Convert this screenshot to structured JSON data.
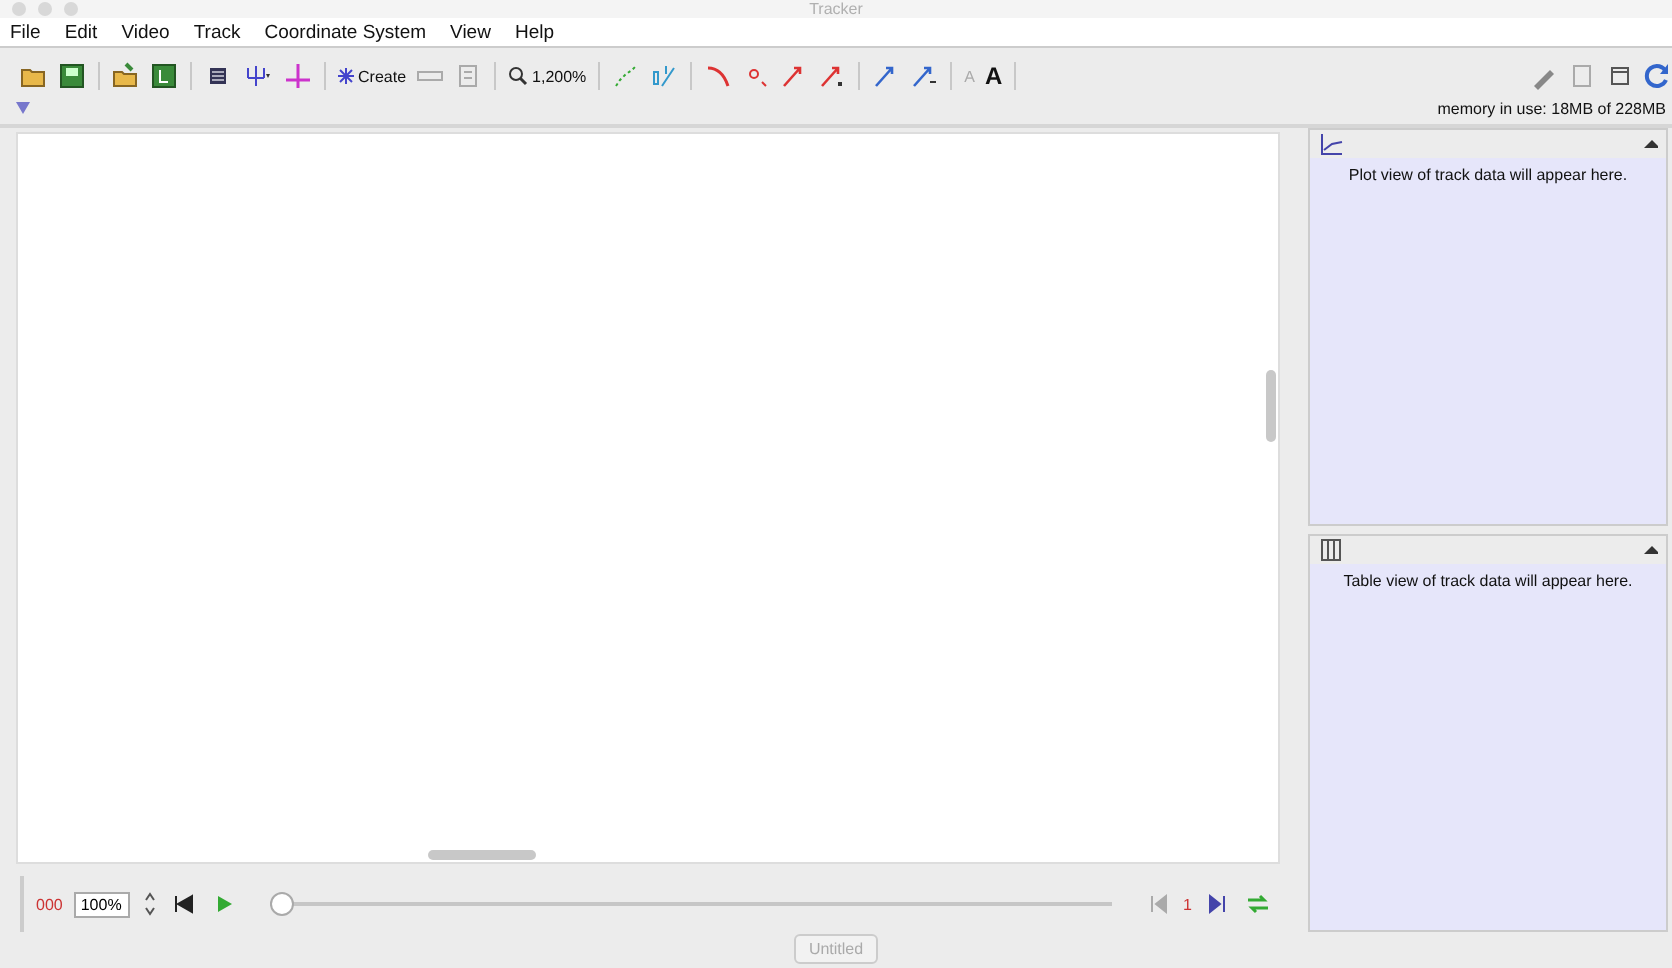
{
  "window": {
    "title": "Tracker"
  },
  "menu": [
    "File",
    "Edit",
    "Video",
    "Track",
    "Coordinate System",
    "View",
    "Help"
  ],
  "toolbar": {
    "create": "Create",
    "zoom": "1,200%",
    "font_smaller": "A",
    "font_larger": "A"
  },
  "memory": "memory in use: 18MB of 228MB",
  "plot_view": {
    "message": "Plot view of track data will appear here."
  },
  "table_view": {
    "message": "Table view of track data will appear here."
  },
  "player": {
    "frame": "000",
    "rate": "100%",
    "level": 0,
    "step": "1"
  },
  "tabs": [
    {
      "label": "Untitled",
      "selected": false
    }
  ]
}
